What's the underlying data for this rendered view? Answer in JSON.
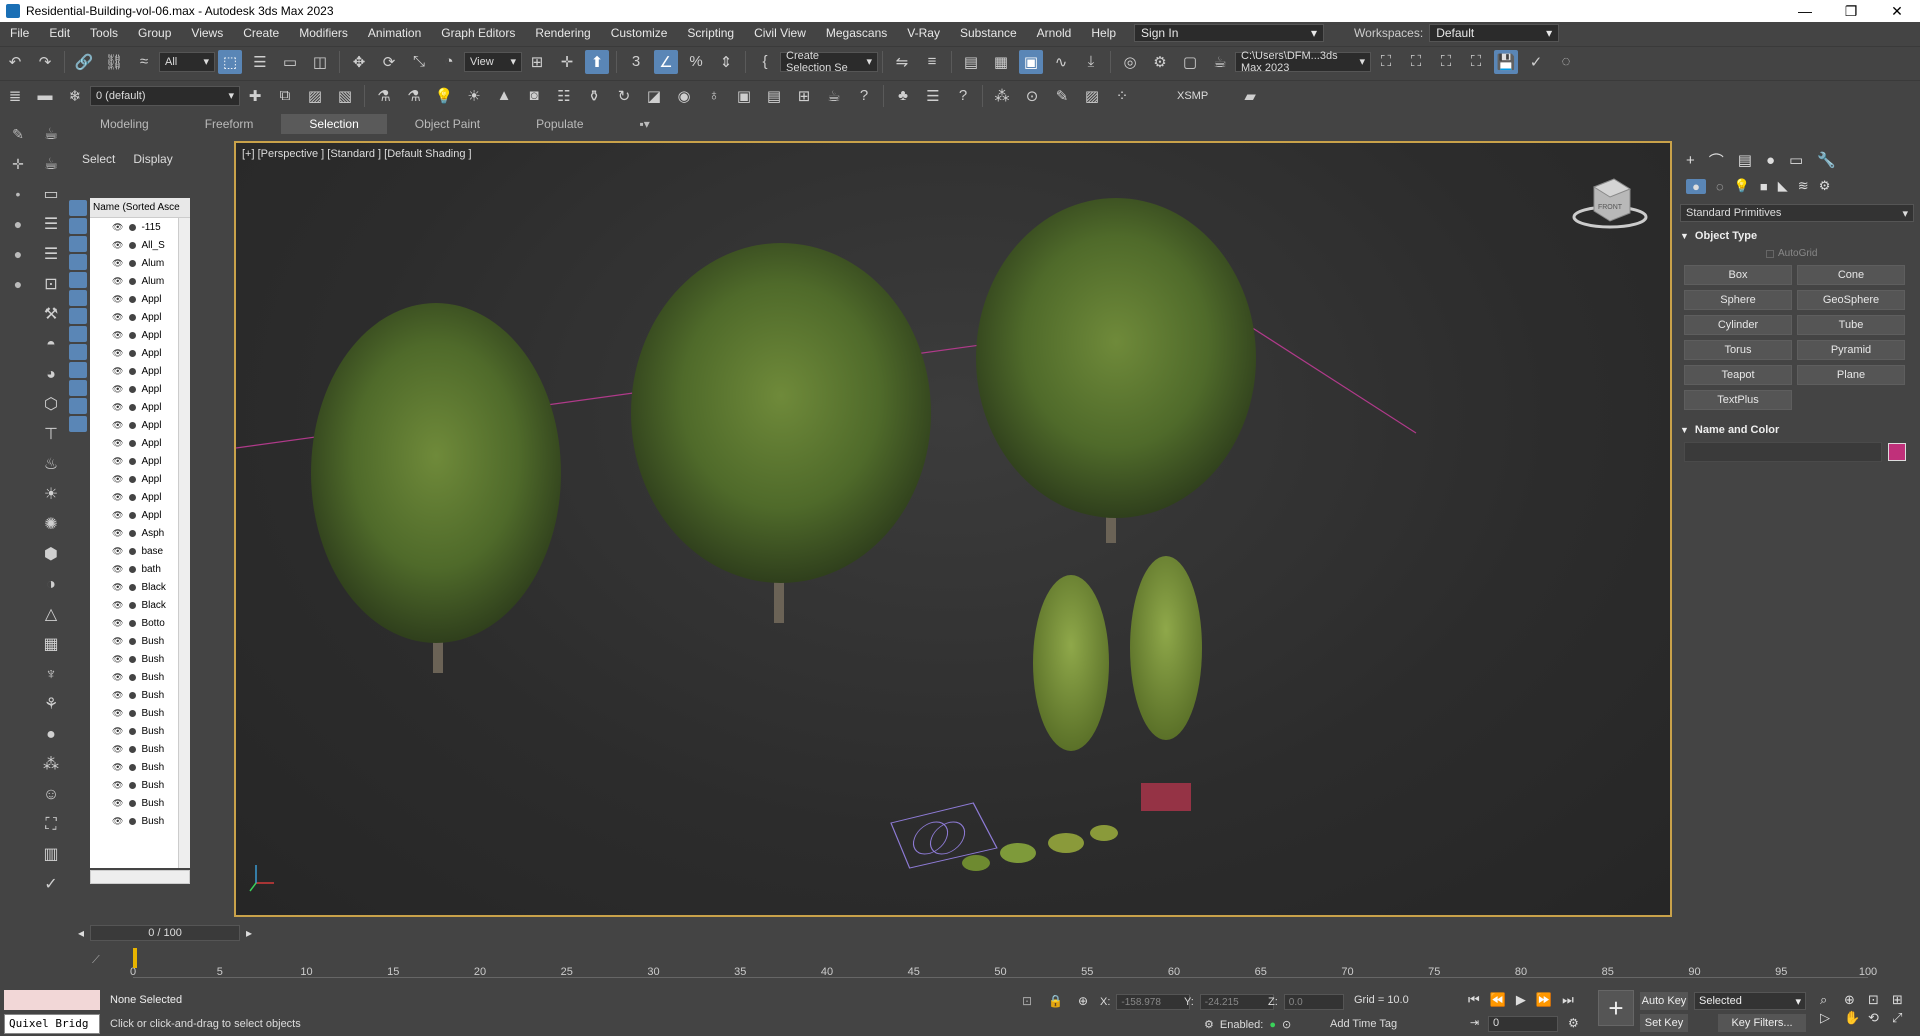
{
  "window": {
    "title": "Residential-Building-vol-06.max - Autodesk 3ds Max 2023",
    "controls": [
      "—",
      "❐",
      "✕"
    ]
  },
  "menubar": {
    "items": [
      "File",
      "Edit",
      "Tools",
      "Group",
      "Views",
      "Create",
      "Modifiers",
      "Animation",
      "Graph Editors",
      "Rendering",
      "Customize",
      "Scripting",
      "Civil View",
      "Megascans",
      "V-Ray",
      "Substance",
      "Arnold",
      "Help"
    ],
    "sign_in": "Sign In",
    "workspaces_label": "Workspaces:",
    "workspace_value": "Default"
  },
  "toolbar1": {
    "selection_filter": "All",
    "ref_coord": "View",
    "named_selection": "Create Selection Se",
    "project_path": "C:\\Users\\DFM...3ds Max 2023"
  },
  "toolbar2": {
    "layer": "0 (default)",
    "xsmp_label": "XSMP"
  },
  "ribbon": {
    "tabs": [
      "Modeling",
      "Freeform",
      "Selection",
      "Object Paint",
      "Populate"
    ]
  },
  "scene_explorer": {
    "tabs": [
      "Select",
      "Display"
    ],
    "column_header": "Name (Sorted Asce",
    "rows": [
      "-115",
      "All_S",
      "Alum",
      "Alum",
      "Appl",
      "Appl",
      "Appl",
      "Appl",
      "Appl",
      "Appl",
      "Appl",
      "Appl",
      "Appl",
      "Appl",
      "Appl",
      "Appl",
      "Appl",
      "Asph",
      "base",
      "bath",
      "Black",
      "Black",
      "Botto",
      "Bush",
      "Bush",
      "Bush",
      "Bush",
      "Bush",
      "Bush",
      "Bush",
      "Bush",
      "Bush",
      "Bush",
      "Bush"
    ]
  },
  "viewport": {
    "label": "[+] [Perspective ] [Standard ] [Default Shading ]",
    "viewcube_label": "FRONT"
  },
  "command_panel": {
    "category": "Standard Primitives",
    "object_type_title": "Object Type",
    "autogrid_label": "AutoGrid",
    "primitives": [
      "Box",
      "Cone",
      "Sphere",
      "GeoSphere",
      "Cylinder",
      "Tube",
      "Torus",
      "Pyramid",
      "Teapot",
      "Plane",
      "TextPlus"
    ],
    "name_color_title": "Name and Color",
    "swatch_color": "#c0307a"
  },
  "timeline": {
    "frame_display": "0 / 100",
    "ticks": [
      "0",
      "5",
      "10",
      "15",
      "20",
      "25",
      "30",
      "35",
      "40",
      "45",
      "50",
      "55",
      "60",
      "65",
      "70",
      "75",
      "80",
      "85",
      "90",
      "95",
      "100"
    ]
  },
  "status": {
    "maxscript_label": "Quixel Bridg",
    "selection_status": "None Selected",
    "prompt": "Click or click-and-drag to select objects",
    "x_label": "X:",
    "x_value": "-158.978",
    "y_label": "Y:",
    "y_value": "-24.215",
    "z_label": "Z:",
    "z_value": "0.0",
    "grid": "Grid = 10.0",
    "enabled_label": "Enabled:",
    "add_time_tag": "Add Time Tag",
    "current_frame": "0",
    "auto_key": "Auto Key",
    "set_key": "Set Key",
    "key_mode": "Selected",
    "key_filters": "Key Filters..."
  },
  "colors": {
    "viewport_border": "#c9a24a",
    "active_blue": "#5a86b6",
    "axis_line": "#b03a8a"
  }
}
